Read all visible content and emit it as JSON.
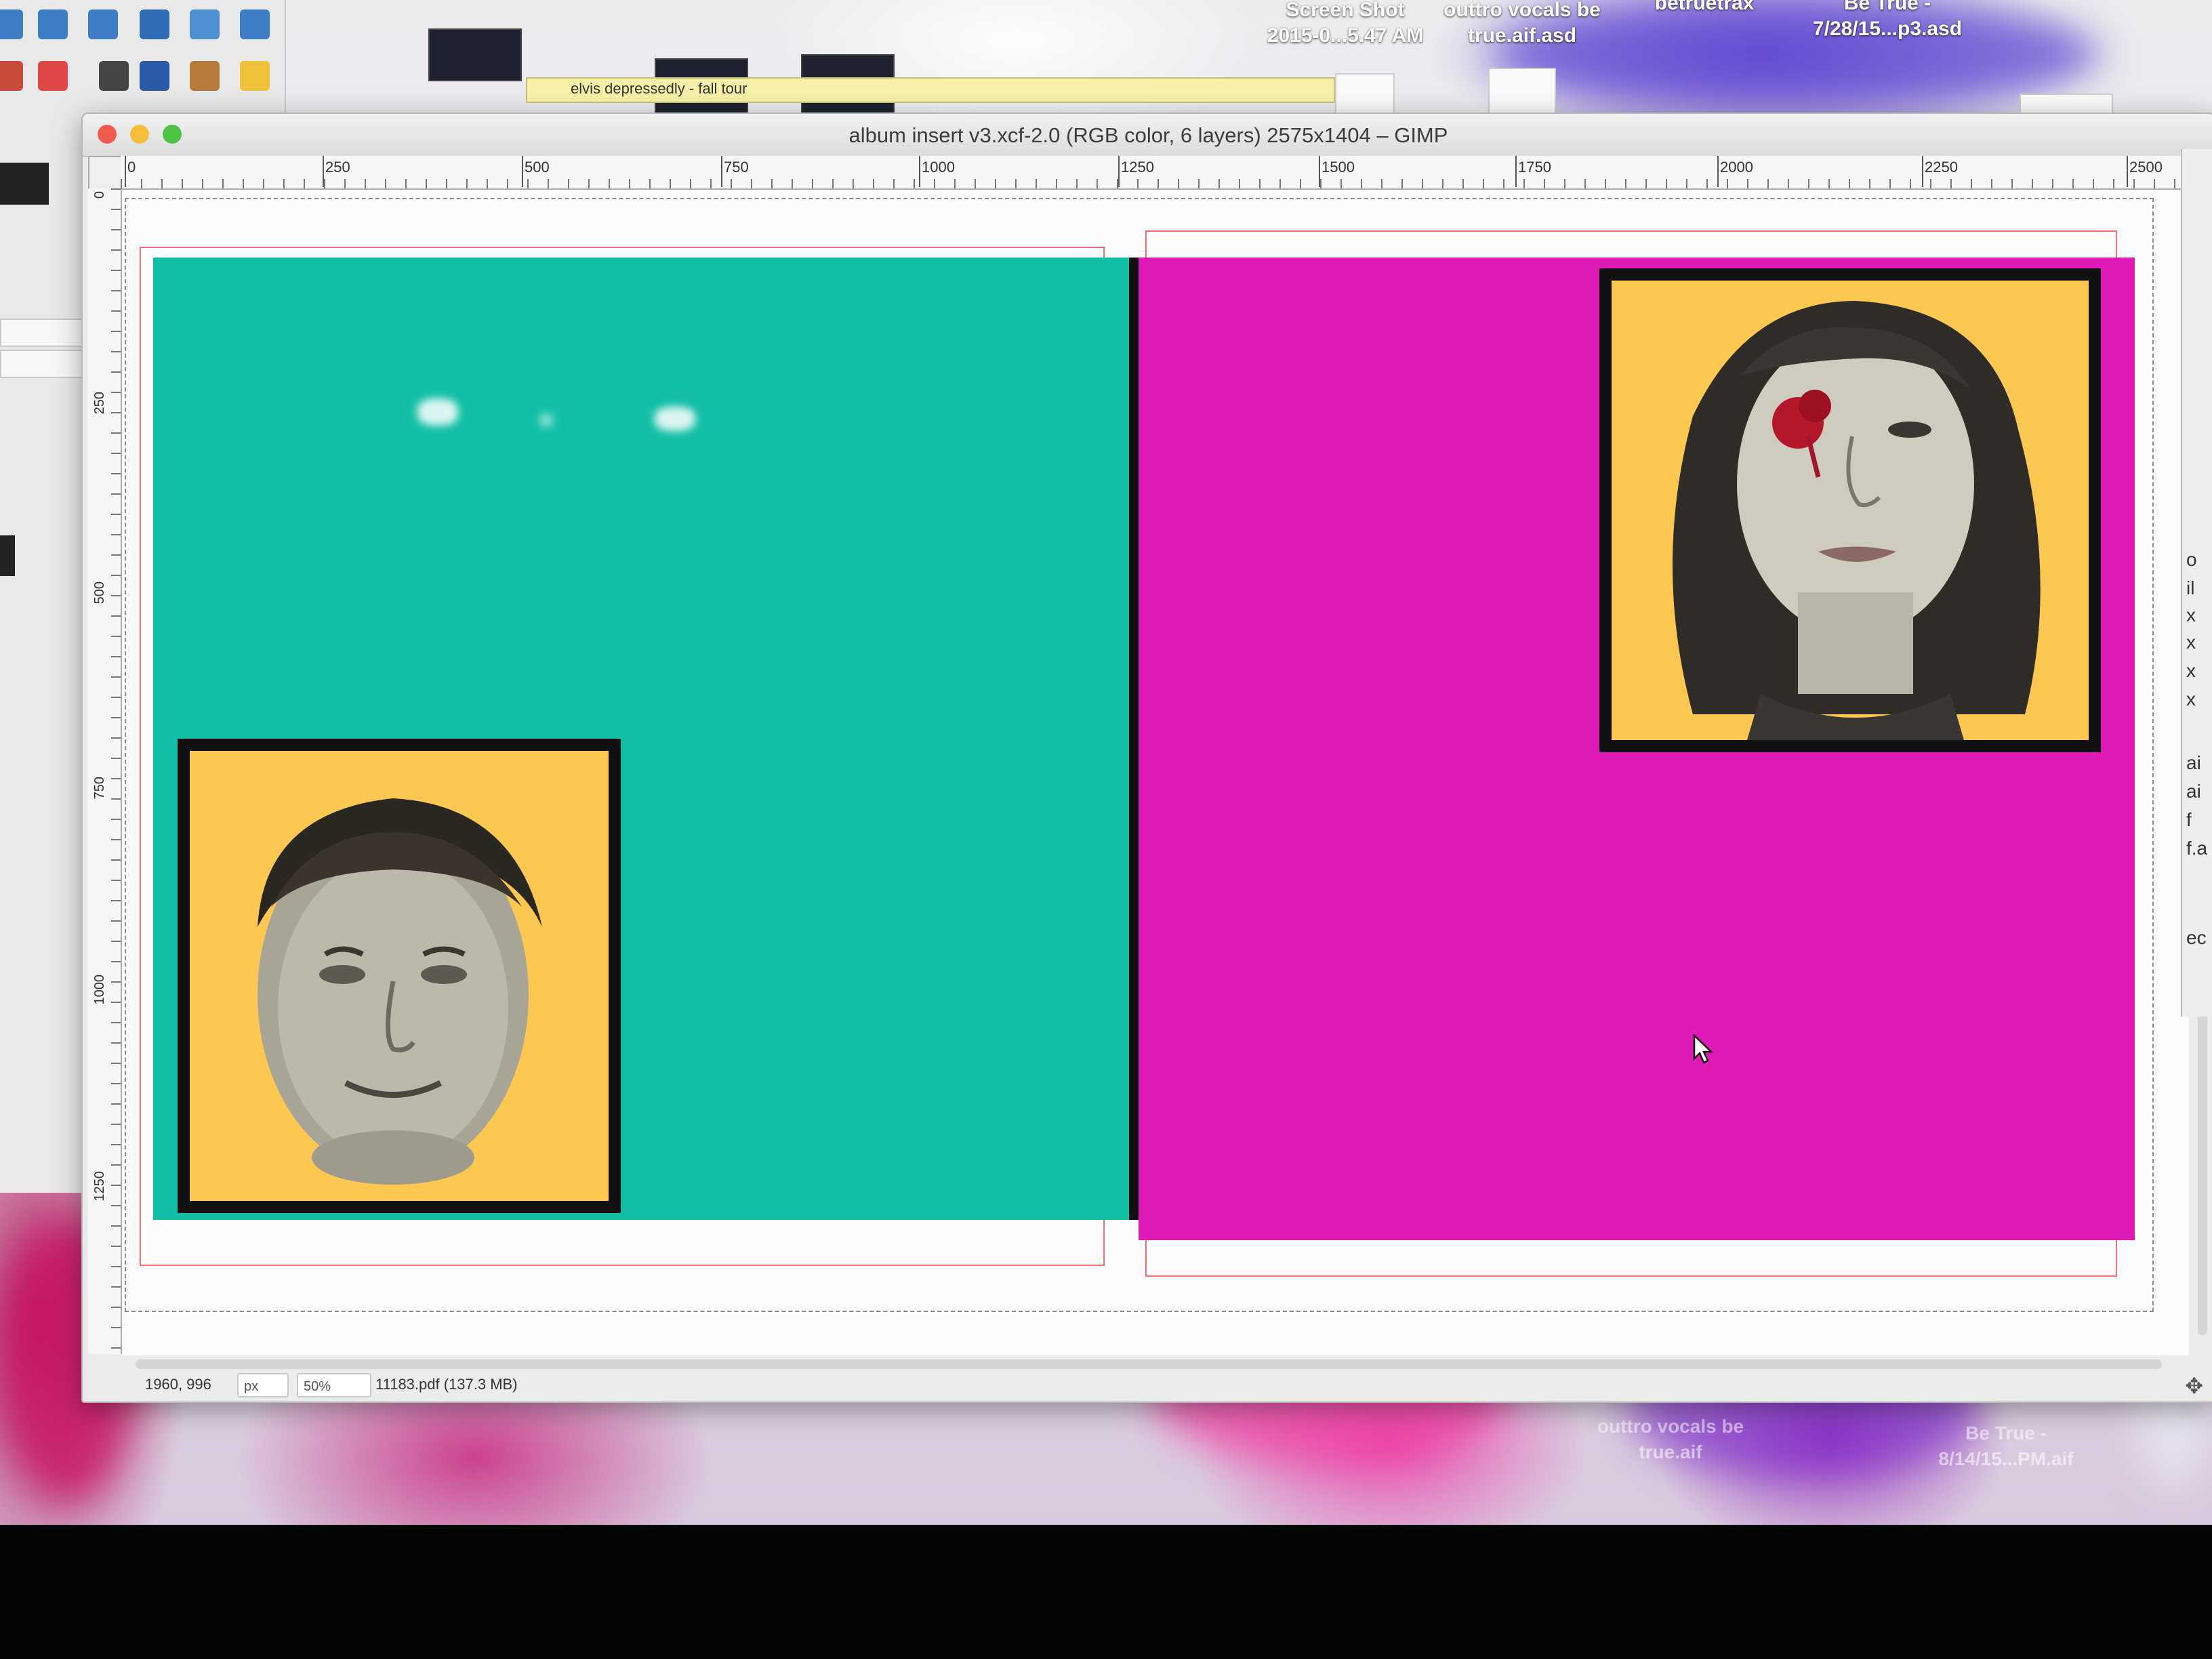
{
  "desktop": {
    "files": [
      {
        "line1": "Screen Shot",
        "line2": "2015-0...5.47 AM"
      },
      {
        "line1": "outtro vocals be",
        "line2": "true.aif.asd"
      },
      {
        "line1": "betruetrax",
        "line2": ""
      },
      {
        "line1": "Be True -",
        "line2": "7/28/15...p3.asd"
      }
    ],
    "bottom_files": [
      {
        "line1": "outtro vocals be",
        "line2": "true.aif"
      },
      {
        "line1": "Be True -",
        "line2": "8/14/15...PM.aif"
      }
    ]
  },
  "layers_strip": {
    "label": "elvis depressedly - fall tour"
  },
  "window": {
    "title": "album insert v3.xcf-2.0 (RGB color, 6 layers) 2575x1404 – GIMP",
    "traffic_lights": {
      "close": "#f05a4f",
      "minimize": "#f4be3b",
      "maximize": "#4ec245"
    }
  },
  "rulers": {
    "horizontal": [
      "0",
      "250",
      "500",
      "750",
      "1000",
      "1250",
      "1500",
      "1750",
      "2000",
      "2250",
      "2500"
    ],
    "vertical": [
      "0",
      "250",
      "500",
      "750",
      "1000",
      "1250"
    ]
  },
  "canvas": {
    "left_color": "#12bfa6",
    "right_color": "#e01bb5",
    "portrait_bg": "#fcc851",
    "left_portrait": "man-portrait-drawing",
    "right_portrait": "woman-portrait-drawing"
  },
  "status": {
    "coords": "1960, 996",
    "unit": "px",
    "zoom": "50%",
    "info": "11183.pdf (137.3 MB)"
  },
  "side_panel": {
    "letters": [
      "o",
      "il",
      "x",
      "x",
      "x",
      "x",
      "ai",
      "ai",
      "f",
      "f.a",
      "ec"
    ]
  }
}
